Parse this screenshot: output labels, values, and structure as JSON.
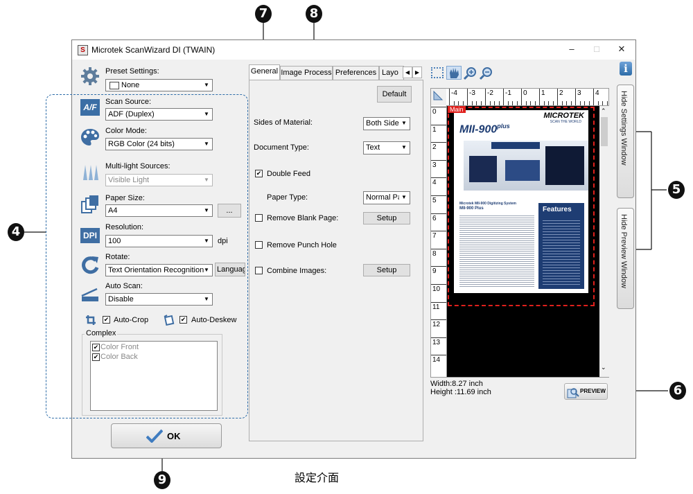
{
  "window": {
    "title": "Microtek ScanWizard DI (TWAIN)",
    "icon": "S",
    "controls": [
      "–",
      "□",
      "✕"
    ]
  },
  "left_panel": {
    "preset": {
      "label": "Preset Settings:",
      "value": "None"
    },
    "scan_source": {
      "label": "Scan Source:",
      "value": "ADF (Duplex)",
      "icon_text": "A/F"
    },
    "color_mode": {
      "label": "Color Mode:",
      "value": "RGB Color (24 bits)"
    },
    "multi_light": {
      "label": "Multi-light Sources:",
      "value": "Visible Light"
    },
    "paper_size": {
      "label": "Paper Size:",
      "value": "A4",
      "more_button": "..."
    },
    "resolution": {
      "label": "Resolution:",
      "value": "100",
      "unit": "dpi",
      "icon_text": "DPI"
    },
    "rotate": {
      "label": "Rotate:",
      "value": "Text Orientation Recognition",
      "language_button": "Language"
    },
    "auto_scan": {
      "label": "Auto Scan:",
      "value": "Disable"
    },
    "auto_crop": {
      "label": "Auto-Crop",
      "checked": true
    },
    "auto_deskew": {
      "label": "Auto-Deskew",
      "checked": true
    },
    "complex": {
      "legend": "Complex",
      "items": [
        {
          "label": "Color Front",
          "checked": true
        },
        {
          "label": "Color Back",
          "checked": true
        }
      ]
    },
    "ok_button": "OK"
  },
  "tabs": {
    "items": [
      "General",
      "Image Process",
      "Preferences",
      "Layo"
    ],
    "active": "General",
    "scroll_left": "◀",
    "scroll_right": "▶"
  },
  "general_tab": {
    "default_button": "Default",
    "sides_of_material": {
      "label": "Sides of Material:",
      "value": "Both Sides"
    },
    "document_type": {
      "label": "Document Type:",
      "value": "Text"
    },
    "double_feed": {
      "label": "Double Feed",
      "checked": true
    },
    "paper_type": {
      "label": "Paper Type:",
      "value": "Normal Pap"
    },
    "remove_blank": {
      "label": "Remove Blank Page:",
      "checked": false,
      "setup": "Setup"
    },
    "remove_punch": {
      "label": "Remove Punch Hole",
      "checked": false
    },
    "combine_images": {
      "label": "Combine Images:",
      "checked": false,
      "setup": "Setup"
    }
  },
  "preview": {
    "ruler_top": [
      "-4",
      "-3",
      "-2",
      "-1",
      "0",
      "1",
      "2",
      "3",
      "4"
    ],
    "ruler_left": [
      "0",
      "1",
      "2",
      "3",
      "4",
      "5",
      "6",
      "7",
      "8",
      "9",
      "10",
      "11",
      "12",
      "13",
      "14"
    ],
    "frame_label": "Main",
    "doc_logo": "MICROTEK",
    "doc_tagline": "SCAN THE WORLD",
    "doc_product": "MII-900",
    "doc_product_suffix": "plus",
    "doc_heading": "Features",
    "doc_subtitle": "Microtek MII-900 Digitizing System",
    "doc_subtitle2": "MII-900 Plus",
    "width_text": "Width:8.27 inch",
    "height_text": "Height :11.69 inch",
    "preview_button": "PREVIEW",
    "hide_settings": "Hide Settings Window",
    "hide_preview": "Hide Preview Window",
    "info_icon": "i"
  },
  "callouts": [
    "7",
    "8",
    "4",
    "5",
    "6",
    "9"
  ],
  "caption": "設定介面",
  "colors": {
    "accent_blue": "#2d6ca8",
    "preview_frame_red": "#e0201c",
    "button_bg": "#e1e1e1",
    "window_bg": "#f0f0f0"
  }
}
